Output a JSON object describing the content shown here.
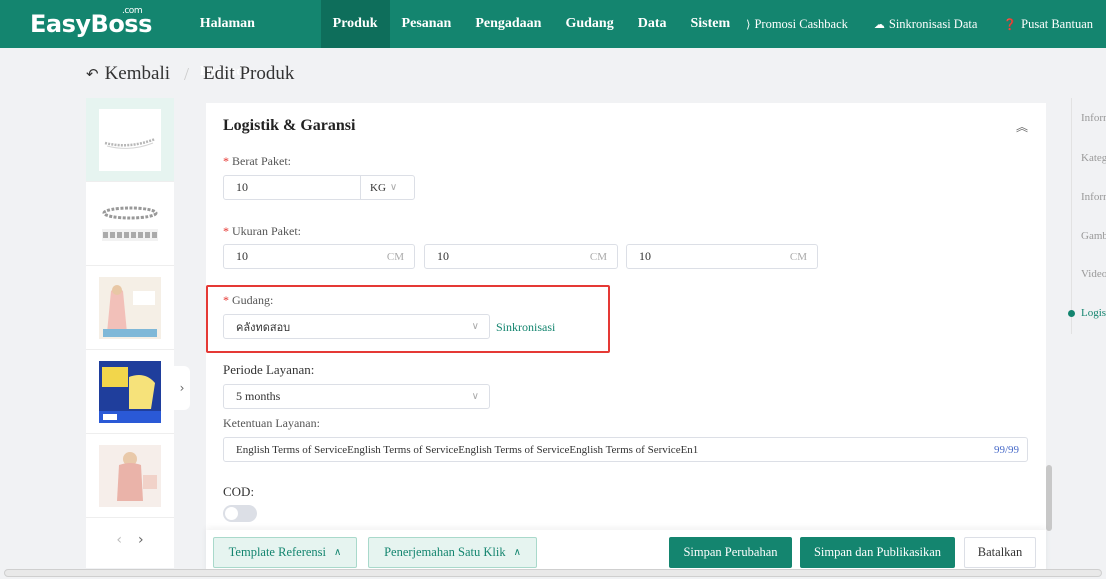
{
  "brand": {
    "logo": "EasyBoss",
    "logo_suffix": ".com"
  },
  "nav": {
    "items": [
      {
        "label": "Halaman Beranda"
      },
      {
        "label": "Produk"
      },
      {
        "label": "Pesanan"
      },
      {
        "label": "Pengadaan"
      },
      {
        "label": "Gudang"
      },
      {
        "label": "Data"
      },
      {
        "label": "Sistem"
      }
    ],
    "active": "Produk",
    "promo": "Promosi Cashback",
    "sync": "Sinkronisasi Data",
    "help": "Pusat Bantuan"
  },
  "breadcrumb": {
    "back": "Kembali",
    "current": "Edit Produk"
  },
  "section": {
    "title": "Logistik & Garansi",
    "weight_label": "Berat Paket:",
    "weight_value": "10",
    "weight_unit": "KG",
    "size_label": "Ukuran Paket:",
    "size_values": [
      "10",
      "10",
      "10"
    ],
    "size_unit": "CM",
    "warehouse_label": "Gudang:",
    "warehouse_value": "คลังทดสอบ",
    "warehouse_sync": "Sinkronisasi",
    "service_period_label": "Periode Layanan:",
    "service_period_value": "5 months",
    "service_terms_label": "Ketentuan Layanan:",
    "service_terms_value": "English Terms of ServiceEnglish Terms of ServiceEnglish Terms of ServiceEnglish Terms of ServiceEn1",
    "service_terms_counter": "99/99",
    "cod_label": "COD:",
    "cod_enabled": false
  },
  "anchors": [
    "Informasi",
    "Kategori",
    "Informasi",
    "Gambar",
    "Video",
    "Logistik"
  ],
  "active_anchor": "Logistik",
  "footer": {
    "template": "Template Referensi",
    "translate": "Penerjemahan Satu Klik",
    "save": "Simpan Perubahan",
    "save_publish": "Simpan dan Publikasikan",
    "cancel": "Batalkan"
  },
  "colors": {
    "brand": "#14856f",
    "brand_dark": "#0e6e5b",
    "required": "#e5322d",
    "highlight": "#e53935"
  }
}
